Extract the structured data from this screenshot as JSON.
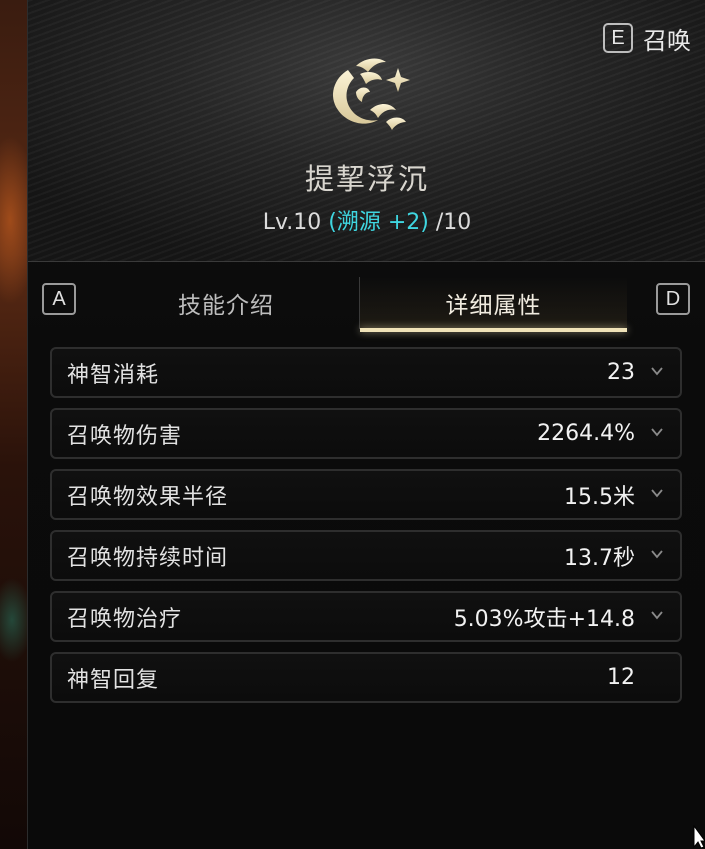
{
  "header": {
    "summon_key": "E",
    "summon_label": "召唤",
    "emblem_icon": "dragon-emblem-icon",
    "skill_name": "提挈浮沉",
    "level_prefix": "Lv.10",
    "level_bonus": "(溯源 +2)",
    "level_max": "/10"
  },
  "tabs": {
    "left_key": "A",
    "right_key": "D",
    "items": [
      {
        "label": "技能介绍",
        "active": false
      },
      {
        "label": "详细属性",
        "active": true
      }
    ]
  },
  "stats": [
    {
      "label": "神智消耗",
      "value": "23",
      "expandable": true
    },
    {
      "label": "召唤物伤害",
      "value": "2264.4%",
      "expandable": true
    },
    {
      "label": "召唤物效果半径",
      "value": "15.5米",
      "expandable": true
    },
    {
      "label": "召唤物持续时间",
      "value": "13.7秒",
      "expandable": true
    },
    {
      "label": "召唤物治疗",
      "value": "5.03%攻击+14.8",
      "expandable": true
    },
    {
      "label": "神智回复",
      "value": "12",
      "expandable": false
    }
  ],
  "colors": {
    "accent_cyan": "#3fd6e0",
    "tab_underline": "#efe2b8",
    "panel_bg": "#0b0b0b"
  }
}
